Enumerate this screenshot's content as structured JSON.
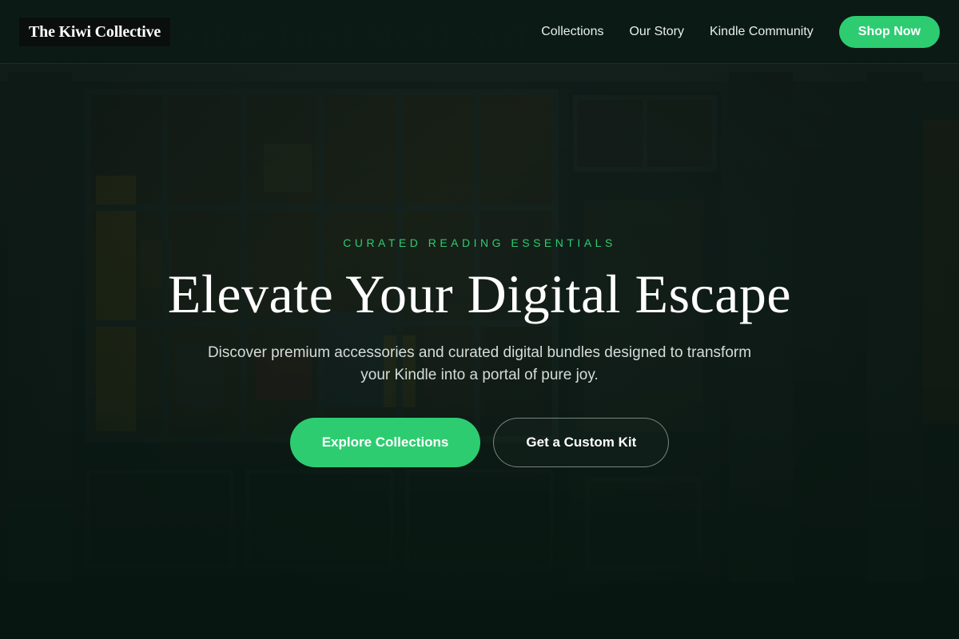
{
  "brand": {
    "name": "The Kiwi Collective"
  },
  "nav": {
    "links": [
      "Collections",
      "Our Story",
      "Kindle Community"
    ],
    "cta_label": "Shop Now"
  },
  "hero": {
    "eyebrow": "CURATED READING ESSENTIALS",
    "headline": "Elevate Your Digital Escape",
    "subtitle": "Discover premium accessories and curated digital bundles designed to transform your Kindle into a portal of pure joy.",
    "primary_cta": "Explore Collections",
    "secondary_cta": "Get a Custom Kit"
  },
  "colors": {
    "accent": "#2ecc71",
    "header_bg": "#0a1a15",
    "page_bg": "#0b1713"
  }
}
